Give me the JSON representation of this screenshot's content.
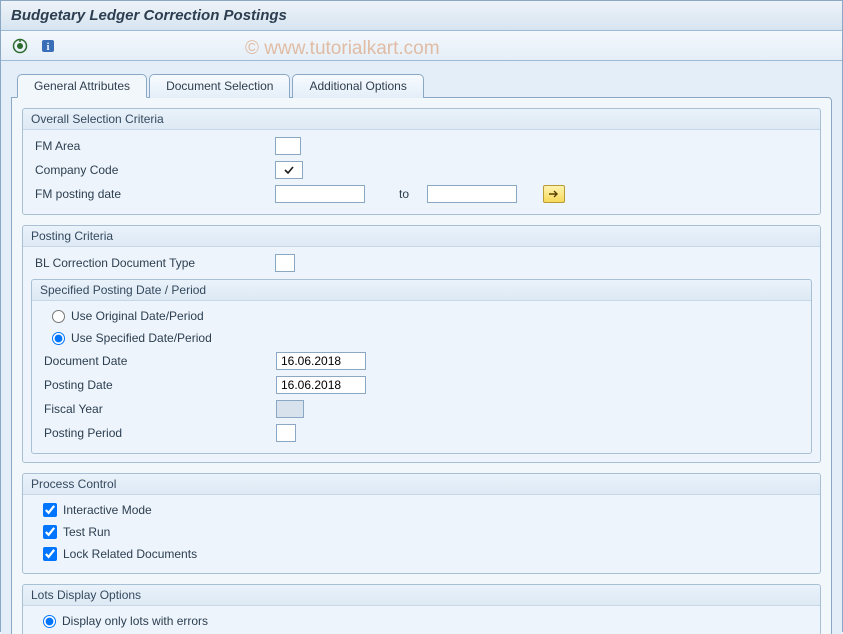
{
  "title": "Budgetary Ledger Correction Postings",
  "watermark": "© www.tutorialkart.com",
  "toolbar": {
    "exec_icon": "execute-icon",
    "info_icon": "info-icon"
  },
  "tabs": [
    {
      "label": "General Attributes",
      "active": true
    },
    {
      "label": "Document Selection",
      "active": false
    },
    {
      "label": "Additional Options",
      "active": false
    }
  ],
  "groups": {
    "overall": {
      "title": "Overall Selection Criteria",
      "fm_area_label": "FM Area",
      "fm_area_value": "",
      "company_code_label": "Company Code",
      "company_code_checked": true,
      "fm_posting_date_label": "FM posting date",
      "fm_posting_from": "",
      "to_label": "to",
      "fm_posting_to": ""
    },
    "posting": {
      "title": "Posting Criteria",
      "bl_doc_type_label": "BL Correction Document Type",
      "bl_doc_type_value": "",
      "subgroup_title": "Specified Posting Date / Period",
      "radio_original": "Use Original Date/Period",
      "radio_specified": "Use Specified Date/Period",
      "radio_selected": "specified",
      "doc_date_label": "Document Date",
      "doc_date_value": "16.06.2018",
      "posting_date_label": "Posting Date",
      "posting_date_value": "16.06.2018",
      "fiscal_year_label": "Fiscal Year",
      "fiscal_year_value": "",
      "posting_period_label": "Posting Period",
      "posting_period_value": ""
    },
    "process": {
      "title": "Process Control",
      "interactive_label": "Interactive Mode",
      "interactive_checked": true,
      "testrun_label": "Test Run",
      "testrun_checked": true,
      "lock_label": "Lock Related Documents",
      "lock_checked": true
    },
    "lots": {
      "title": "Lots Display Options",
      "radio_errors_label": "Display only lots with errors",
      "radio_errors_selected": true
    }
  }
}
